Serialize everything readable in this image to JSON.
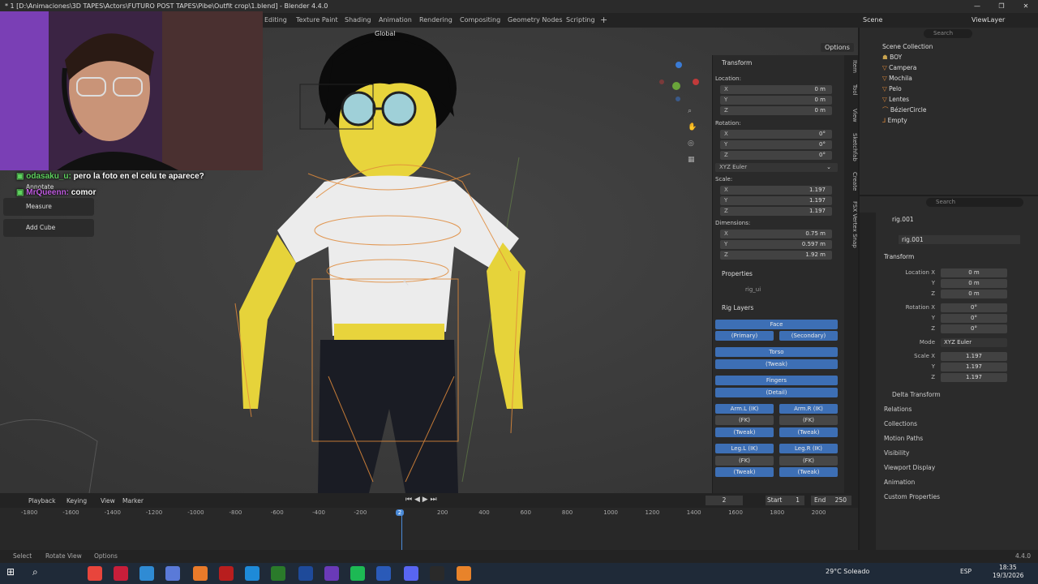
{
  "window": {
    "title": "* 1 [D:\\Animaciones\\3D TAPES\\Actors\\FUTURO POST TAPES\\Pibe\\Outfit crop\\1.blend] - Blender 4.4.0"
  },
  "workspaces": [
    "Editing",
    "Texture Paint",
    "Shading",
    "Animation",
    "Rendering",
    "Compositing",
    "Geometry Nodes",
    "Scripting"
  ],
  "top_right": {
    "scene": "Scene",
    "view_layer": "ViewLayer"
  },
  "viewport": {
    "orientation": "Global",
    "options": "Options"
  },
  "chat": [
    {
      "user": "odasaku_u:",
      "text": "pero la foto en el celu te aparece?",
      "color": "#5fd35f"
    },
    {
      "user": "MrQueenn:",
      "text": "comor",
      "color": "#c05be0"
    }
  ],
  "tools": {
    "annotate": "Annotate",
    "measure": "Measure",
    "add_cube": "Add Cube"
  },
  "npanel": {
    "transform_title": "Transform",
    "location_label": "Location:",
    "location": [
      {
        "k": "X",
        "v": "0 m"
      },
      {
        "k": "Y",
        "v": "0 m"
      },
      {
        "k": "Z",
        "v": "0 m"
      }
    ],
    "rotation_label": "Rotation:",
    "rotation": [
      {
        "k": "X",
        "v": "0°"
      },
      {
        "k": "Y",
        "v": "0°"
      },
      {
        "k": "Z",
        "v": "0°"
      }
    ],
    "euler": "XYZ Euler",
    "scale_label": "Scale:",
    "scale": [
      {
        "k": "X",
        "v": "1.197"
      },
      {
        "k": "Y",
        "v": "1.197"
      },
      {
        "k": "Z",
        "v": "1.197"
      }
    ],
    "dimensions_label": "Dimensions:",
    "dimensions": [
      {
        "k": "X",
        "v": "0.75 m"
      },
      {
        "k": "Y",
        "v": "0.597 m"
      },
      {
        "k": "Z",
        "v": "1.92 m"
      }
    ],
    "properties_title": "Properties",
    "rig_ui": "rig_ui",
    "rig_layers_title": "Rig Layers",
    "face": "Face",
    "primary": "(Primary)",
    "secondary": "(Secondary)",
    "torso": "Torso",
    "tweak": "(Tweak)",
    "fingers": "Fingers",
    "detail": "(Detail)",
    "arm_l": "Arm.L (IK)",
    "arm_r": "Arm.R (IK)",
    "fk": "(FK)",
    "leg_l": "Leg.L (IK)",
    "leg_r": "Leg.R (IK)"
  },
  "sidetabs": [
    "Item",
    "Tool",
    "View",
    "Sketchfab",
    "Create",
    "FSX Vertex Snap"
  ],
  "outliner": {
    "title": "Scene Collection",
    "search": "Search",
    "items": [
      "BOY",
      "Campera",
      "Mochila",
      "Pelo",
      "Lentes",
      "BézierCircle",
      "Empty"
    ]
  },
  "properties": {
    "search": "Search",
    "object": "rig.001",
    "data_name": "rig.001",
    "transform": "Transform",
    "location_label": "Location X",
    "loc": [
      "0 m",
      "0 m",
      "0 m"
    ],
    "rotation_label": "Rotation X",
    "rot": [
      "0°",
      "0°",
      "0°"
    ],
    "mode_label": "Mode",
    "mode": "XYZ Euler",
    "scale_label": "Scale X",
    "scale": [
      "1.197",
      "1.197",
      "1.197"
    ],
    "y": "Y",
    "z": "Z",
    "sections": [
      "Delta Transform",
      "Relations",
      "Collections",
      "Motion Paths",
      "Visibility",
      "Viewport Display",
      "Animation",
      "Custom Properties"
    ]
  },
  "timeline": {
    "menus": [
      "Playback",
      "Keying",
      "View",
      "Marker"
    ],
    "current": "2",
    "start_label": "Start",
    "start": "1",
    "end_label": "End",
    "end": "250",
    "ticks": [
      "-1800",
      "-1600",
      "-1400",
      "-1200",
      "-1000",
      "-800",
      "-600",
      "-400",
      "-200",
      "2",
      "200",
      "400",
      "600",
      "800",
      "1000",
      "1200",
      "1400",
      "1600",
      "1800",
      "2000"
    ]
  },
  "statusbar": {
    "select": "Select",
    "rotate": "Rotate View",
    "options": "Options",
    "version": "4.4.0"
  },
  "taskbar": {
    "weather": "29°C  Soleado",
    "lang": "ESP",
    "time": "18:35",
    "date": "19/3/2026"
  }
}
